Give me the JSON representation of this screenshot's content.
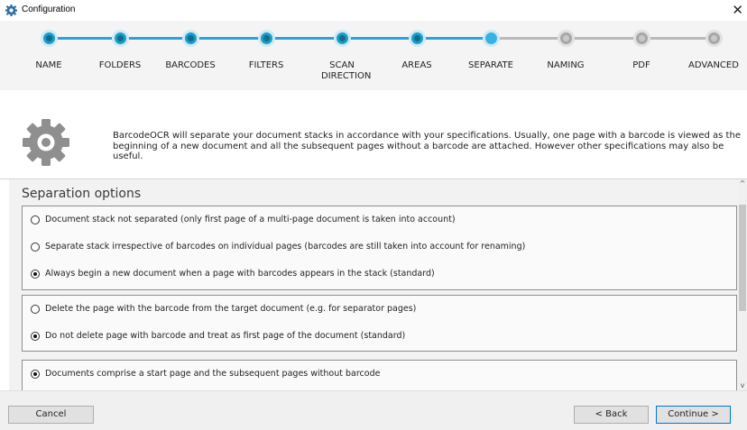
{
  "window": {
    "title": "Configuration",
    "close_glyph": "✕",
    "icon": "gear-icon"
  },
  "wizard": {
    "steps": [
      {
        "label": "NAME",
        "state": "done"
      },
      {
        "label": "FOLDERS",
        "state": "done"
      },
      {
        "label": "BARCODES",
        "state": "done"
      },
      {
        "label": "FILTERS",
        "state": "done"
      },
      {
        "label": "SCAN DIRECTION",
        "state": "done"
      },
      {
        "label": "AREAS",
        "state": "done"
      },
      {
        "label": "SEPARATE",
        "state": "current"
      },
      {
        "label": "NAMING",
        "state": "todo"
      },
      {
        "label": "PDF",
        "state": "todo"
      },
      {
        "label": "ADVANCED",
        "state": "todo"
      }
    ],
    "active_color": "#2ba3d6",
    "inactive_color": "#b9b9b9"
  },
  "info": {
    "icon": "gear-icon",
    "description": "BarcodeOCR will separate your document stacks in accordance with your specifications. Usually, one page with a barcode is viewed as the beginning of a new document and all the subsequent pages without a barcode are attached. However other specifications may also be useful."
  },
  "options": {
    "heading": "Separation options",
    "group1": [
      {
        "label": "Document stack not separated (only first page of a multi-page document is taken into account)",
        "selected": false
      },
      {
        "label": "Separate stack irrespective of barcodes on individual pages (barcodes are still taken into account for renaming)",
        "selected": false
      },
      {
        "label": "Always begin a new document when a page with barcodes appears in the stack (standard)",
        "selected": true
      }
    ],
    "group2": [
      {
        "label": "Delete the page with the barcode from the target document (e.g. for separator pages)",
        "selected": false
      },
      {
        "label": "Do not delete page with barcode and treat as first page of the document (standard)",
        "selected": true
      }
    ],
    "group3": [
      {
        "label": "Documents comprise a start page and the subsequent pages without barcode",
        "selected": true
      }
    ]
  },
  "scrollbar": {
    "up_glyph": "^",
    "down_glyph": "v"
  },
  "footer": {
    "cancel_label": "Cancel",
    "back_label": "< Back",
    "continue_label": "Continue >"
  }
}
